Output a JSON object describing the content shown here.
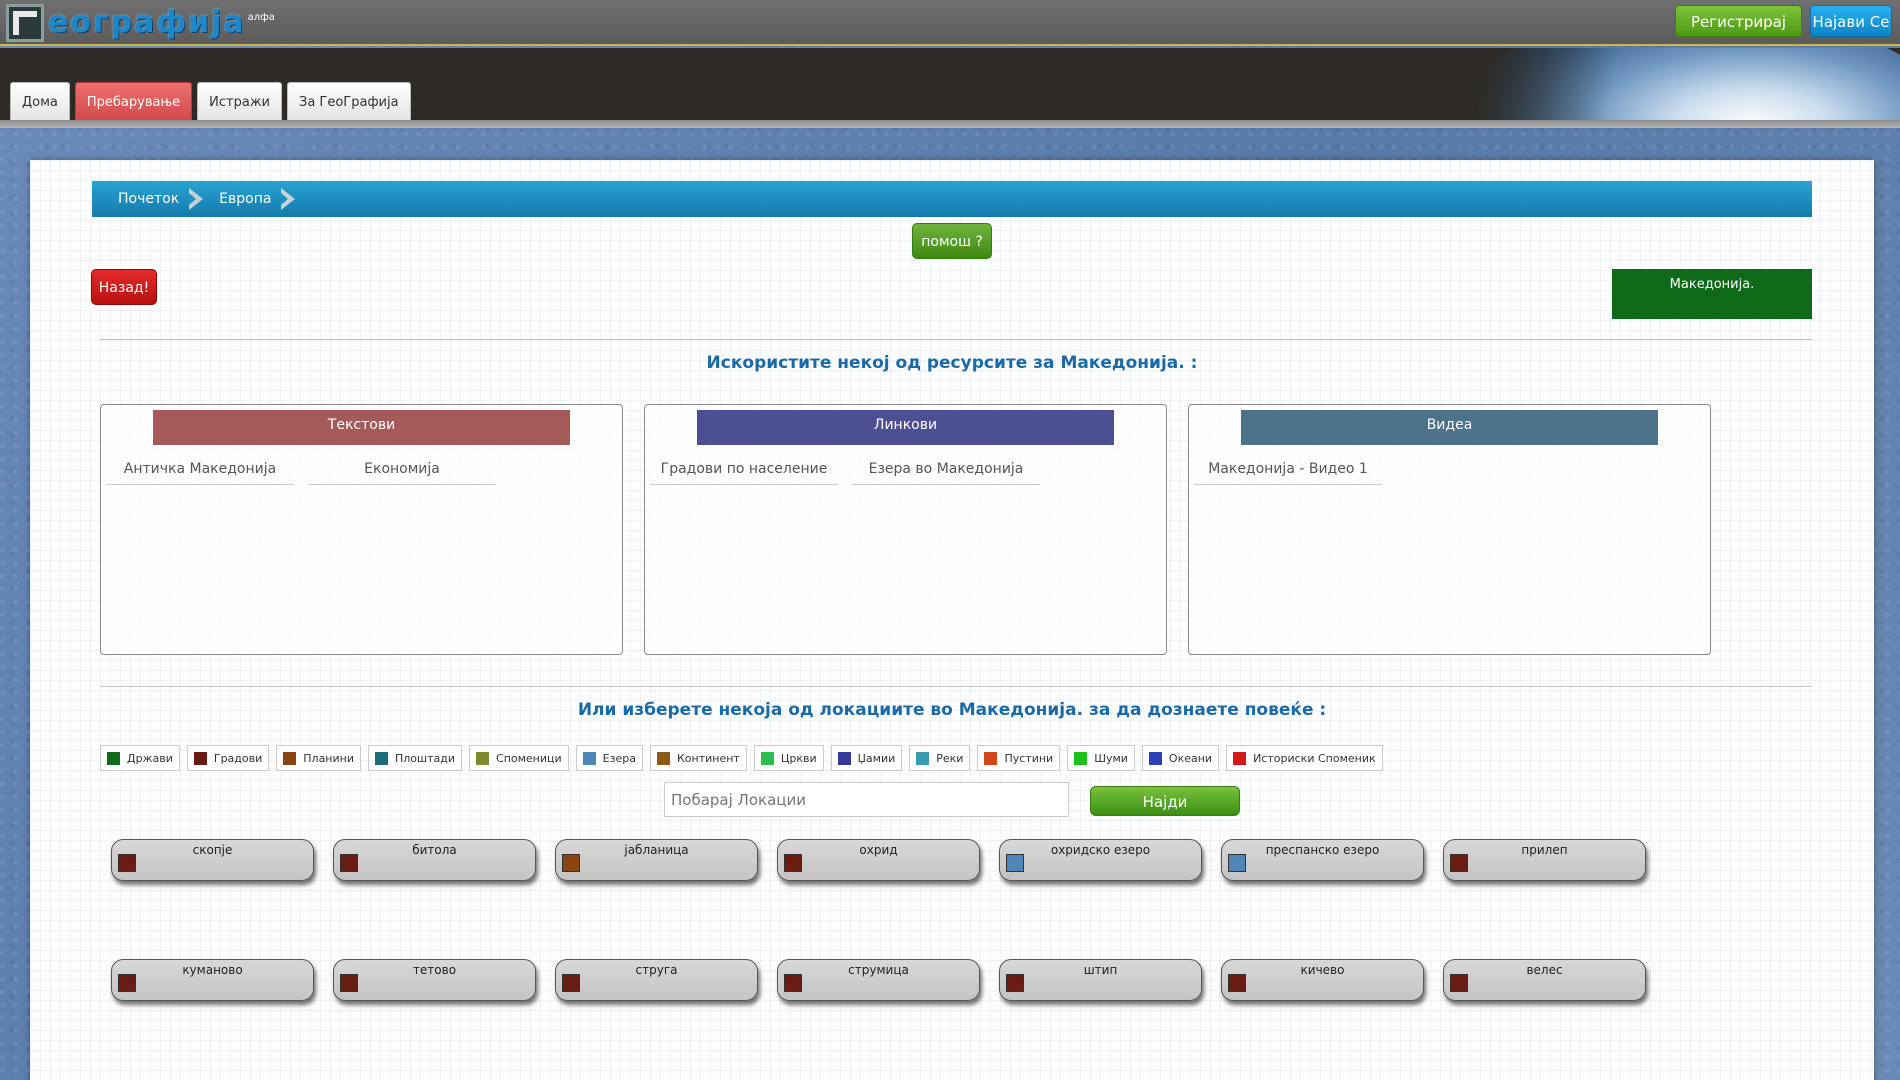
{
  "header": {
    "logo_text": "еографија",
    "logo_sup": "алфа",
    "register_label": "Регистрирај Се!",
    "login_label": "Најави Се"
  },
  "nav": {
    "tabs": [
      {
        "label": "Дома",
        "active": false
      },
      {
        "label": "Пребарување",
        "active": true
      },
      {
        "label": "Истражи",
        "active": false
      },
      {
        "label": "За ГеоГрафија",
        "active": false
      }
    ]
  },
  "breadcrumb": [
    "Почеток",
    "Европа"
  ],
  "help_label": "помош ?",
  "back_label": "Назад!",
  "current_place": "Македонија.",
  "resources": {
    "title": "Искористите некој од ресурсите за Македонија. :",
    "boxes": [
      {
        "heading": "Текстови",
        "color": "#a45a58",
        "items": [
          "Античка Македонија",
          "Економија"
        ]
      },
      {
        "heading": "Линкови",
        "color": "#4d4f93",
        "items": [
          "Градови по население",
          "Езера во Македонија"
        ]
      },
      {
        "heading": "Видеа",
        "color": "#4c7389",
        "items": [
          "Македонија - Видео 1"
        ]
      }
    ]
  },
  "locations": {
    "title": "Или изберете некоја од локациите во Македонија. за да дознаете повеќе :",
    "legend": [
      {
        "label": "Држави",
        "color": "#0e6a19"
      },
      {
        "label": "Градови",
        "color": "#6a1c12"
      },
      {
        "label": "Планини",
        "color": "#8b4513"
      },
      {
        "label": "Плоштади",
        "color": "#1b6b78"
      },
      {
        "label": "Споменици",
        "color": "#7f8a30"
      },
      {
        "label": "Езера",
        "color": "#4f86b8"
      },
      {
        "label": "Континент",
        "color": "#8a5a16"
      },
      {
        "label": "Цркви",
        "color": "#2bbd4f"
      },
      {
        "label": "Џамии",
        "color": "#353a9a"
      },
      {
        "label": "Реки",
        "color": "#3a9bb0"
      },
      {
        "label": "Пустини",
        "color": "#d2481c"
      },
      {
        "label": "Шуми",
        "color": "#1ec21e"
      },
      {
        "label": "Океани",
        "color": "#2e3fb6"
      },
      {
        "label": "Историски Споменик",
        "color": "#d41a1a"
      }
    ],
    "search_placeholder": "Побарај Локации",
    "find_label": "Најди",
    "items": [
      {
        "name": "скопје",
        "color": "#6a1c12"
      },
      {
        "name": "битола",
        "color": "#6a1c12"
      },
      {
        "name": "јабланица",
        "color": "#8b4513"
      },
      {
        "name": "охрид",
        "color": "#6a1c12"
      },
      {
        "name": "охридско езеро",
        "color": "#4f86b8"
      },
      {
        "name": "преспанско езеро",
        "color": "#4f86b8"
      },
      {
        "name": "прилеп",
        "color": "#6a1c12"
      },
      {
        "name": "куманово",
        "color": "#6a1c12"
      },
      {
        "name": "тетово",
        "color": "#6a1c12"
      },
      {
        "name": "струга",
        "color": "#6a1c12"
      },
      {
        "name": "струмица",
        "color": "#6a1c12"
      },
      {
        "name": "штип",
        "color": "#6a1c12"
      },
      {
        "name": "кичево",
        "color": "#6a1c12"
      },
      {
        "name": "велес",
        "color": "#6a1c12"
      }
    ]
  }
}
